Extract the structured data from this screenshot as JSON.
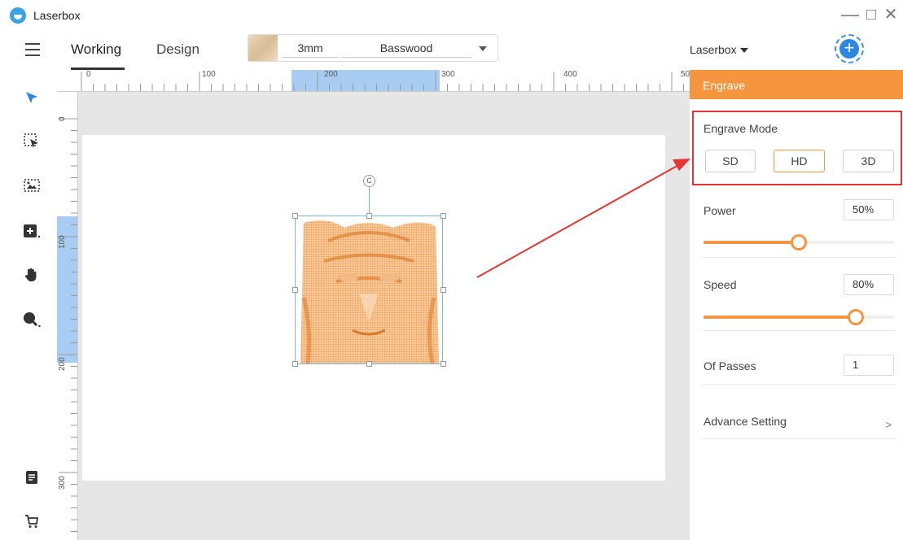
{
  "window": {
    "title": "Laserbox",
    "minimize": "—",
    "maximize": "□",
    "close": "✕"
  },
  "toolbar": {
    "tabs": [
      {
        "label": "Working"
      },
      {
        "label": "Design"
      }
    ],
    "material": {
      "thickness": "3mm",
      "wood": "Basswood"
    },
    "device": "Laserbox",
    "add_button": "+"
  },
  "ruler": {
    "h_labels": [
      "0",
      "100",
      "200",
      "300",
      "400",
      "50"
    ],
    "v_labels": [
      "0",
      "100",
      "200",
      "300"
    ]
  },
  "canvas": {
    "rotate_handle": "C"
  },
  "panel": {
    "header": "Engrave",
    "engrave_mode": {
      "label": "Engrave Mode",
      "options": [
        "SD",
        "HD",
        "3D"
      ],
      "selected": "HD"
    },
    "power": {
      "label": "Power",
      "value": "50%",
      "level": 0.5
    },
    "speed": {
      "label": "Speed",
      "value": "80%",
      "level": 0.8
    },
    "passes": {
      "label": "Of Passes",
      "value": "1"
    },
    "advance": {
      "label": "Advance Setting",
      "chevron": ">"
    }
  },
  "colors": {
    "accent": "#f6953f",
    "highlight_box": "#e53431",
    "selection": "#7ab8e6",
    "brand_blue": "#2f86e0"
  },
  "icons": [
    "menu-icon",
    "pointer-icon",
    "box-select-icon",
    "image-icon",
    "add-shape-icon",
    "hand-icon",
    "zoom-icon",
    "document-icon",
    "cart-icon"
  ]
}
